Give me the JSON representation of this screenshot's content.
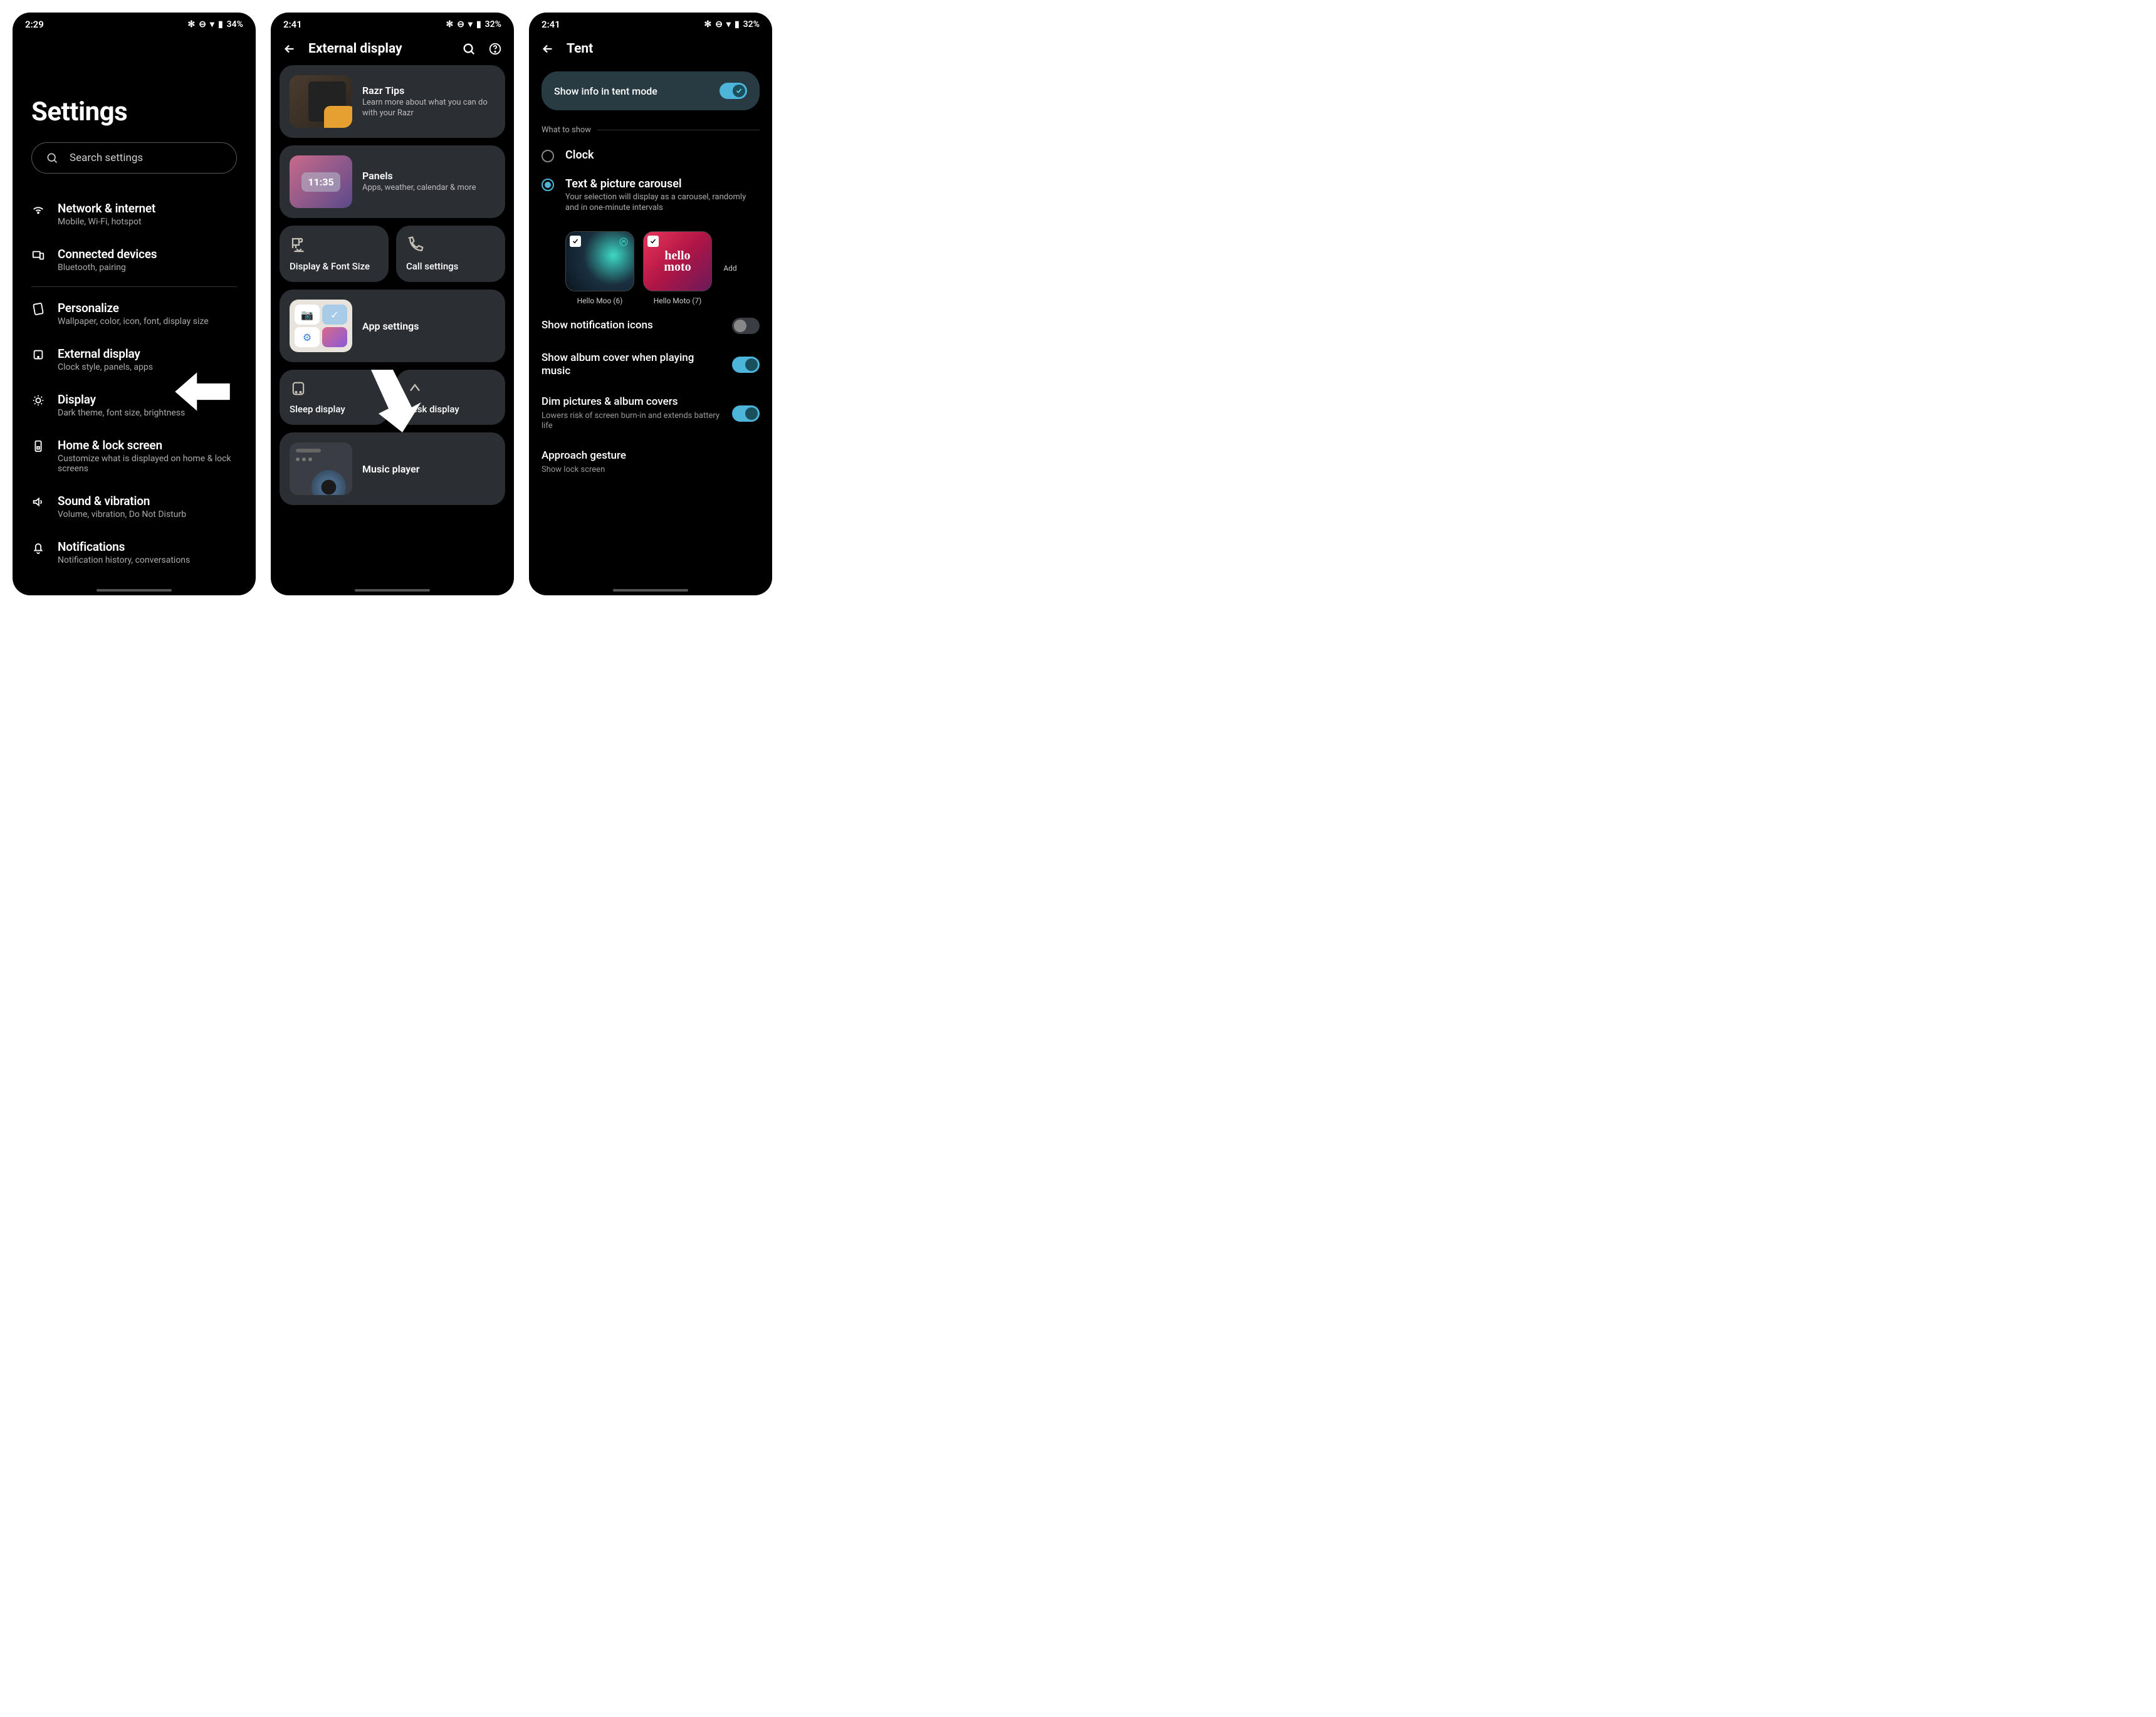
{
  "s1": {
    "time": "2:29",
    "battery": "34%",
    "title": "Settings",
    "search_placeholder": "Search settings",
    "items": [
      {
        "title": "Network & internet",
        "desc": "Mobile, Wi-Fi, hotspot"
      },
      {
        "title": "Connected devices",
        "desc": "Bluetooth, pairing"
      },
      {
        "title": "Personalize",
        "desc": "Wallpaper, color, icon, font, display size"
      },
      {
        "title": "External display",
        "desc": "Clock style, panels, apps"
      },
      {
        "title": "Display",
        "desc": "Dark theme, font size, brightness"
      },
      {
        "title": "Home & lock screen",
        "desc": "Customize what is displayed on home & lock screens"
      },
      {
        "title": "Sound & vibration",
        "desc": "Volume, vibration, Do Not Disturb"
      },
      {
        "title": "Notifications",
        "desc": "Notification history, conversations"
      }
    ]
  },
  "s2": {
    "time": "2:41",
    "battery": "32%",
    "title": "External display",
    "cards": {
      "razr_tips": {
        "title": "Razr Tips",
        "desc": "Learn more about what you can do with your Razr"
      },
      "panels": {
        "title": "Panels",
        "desc": "Apps, weather, calendar & more",
        "clock": "11:35"
      },
      "display_font": "Display & Font Size",
      "call_settings": "Call settings",
      "app_settings": "App settings",
      "sleep_display": "Sleep display",
      "desk_display": "Desk display",
      "music_player": "Music player"
    }
  },
  "s3": {
    "time": "2:41",
    "battery": "32%",
    "title": "Tent",
    "tentmode_label": "Show info in tent mode",
    "section": "What to show",
    "radios": {
      "clock": "Clock",
      "carousel_t": "Text & picture carousel",
      "carousel_d": "Your selection will display as a carousel, randomly and in one-minute intervals"
    },
    "thumbs": [
      {
        "cap": "Hello Moo (6)"
      },
      {
        "cap": "Hello Moto (7)"
      }
    ],
    "addmore": "Add",
    "settings": [
      {
        "t": "Show notification icons",
        "on": false
      },
      {
        "t": "Show album cover when playing music",
        "on": true
      },
      {
        "t": "Dim pictures & album covers",
        "d": "Lowers risk of screen burn-in and extends battery life",
        "on": true
      },
      {
        "t": "Approach gesture",
        "d": "Show lock screen"
      }
    ]
  }
}
